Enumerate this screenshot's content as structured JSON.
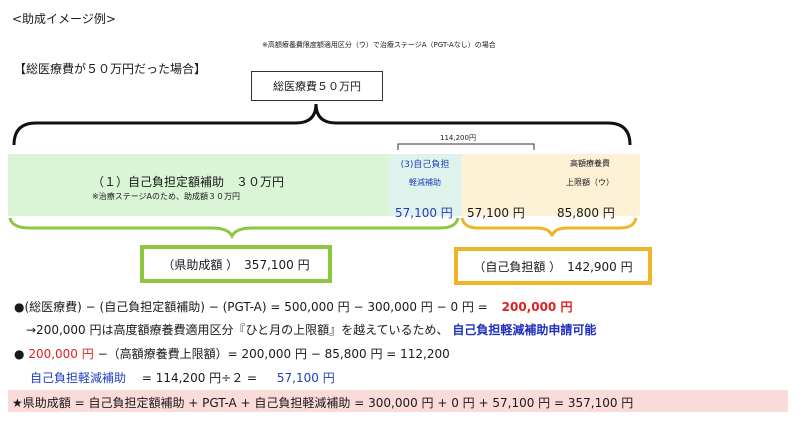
{
  "header": {
    "example_title": "<助成イメージ例>",
    "note_top": "※高額療養費限度額適用区分（ウ）で治療ステージA（PGT-Aなし）の場合",
    "case_title": "【総医療費が５０万円だった場合】",
    "total_box": "総医療費５０万円"
  },
  "diagram": {
    "bracket_label": "114,200円",
    "green_main": "（１）自己負担定額補助　３０万円",
    "green_sub": "※治療ステージAのため、助成額３０万円",
    "blue_cell_line1": "(3)自己負担",
    "blue_cell_line2": "軽減補助",
    "orange_cell_line1": "高額療養費",
    "orange_cell_line2": "上限額（ウ）",
    "value_blue": "57,100 円",
    "value_mid": "57,100 円",
    "value_right": "85,800 円",
    "pref_box": "（県助成額 ）　357,100 円",
    "self_box": "（自己負担額 ）　142,900 円"
  },
  "formulas": {
    "line1_text": "●(総医療費) − (自己負担定額補助) − (PGT-A) = 500,000 円 − 300,000 円 − 0 円 =",
    "line1_result": "200,000 円",
    "line2_text": "→200,000 円は高度額療養費適用区分『ひと月の上限額』を越えているため、",
    "line2_emph": "自己負担軽減補助申請可能",
    "line3_bullet": "●",
    "line3_red": "200,000 円",
    "line3_text": "−（高額療養費上限額）= 200,000 円 − 85,800 円 = 112,200",
    "line4_label": "自己負担軽減補助",
    "line4_text": "= 114,200 円÷２ =",
    "line4_result": "57,100 円",
    "line5_text": "★県助成額 = 自己負担定額補助 + PGT-A + 自己負担軽減補助 = 300,000 円 + 0 円 + 57,100 円 = 357,100 円"
  },
  "colors": {
    "green_fill": "#d9f5d6",
    "blue_fill": "#dff3ec",
    "orange_fill": "#fdf1d6",
    "green_border": "#8dc63f",
    "orange_border": "#f0b429",
    "pink_band": "#fbdada",
    "blue_text": "#1f3fbf",
    "red_text": "#e02020"
  }
}
